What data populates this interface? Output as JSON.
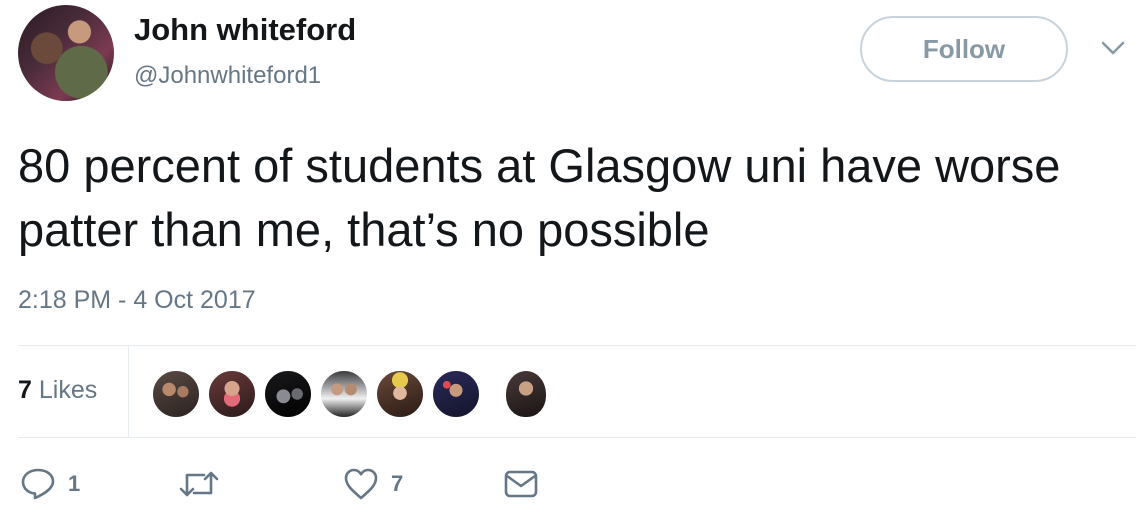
{
  "author": {
    "name": "John whiteford",
    "handle": "@Johnwhiteford1"
  },
  "follow_label": "Follow",
  "tweet": {
    "text": "80 percent of students at Glasgow uni have worse patter than me, that’s no possible",
    "timestamp": "2:18 PM - 4 Oct 2017"
  },
  "likes": {
    "count": "7",
    "label": "Likes"
  },
  "likers": [
    {
      "icon": "liker-avatar-1"
    },
    {
      "icon": "liker-avatar-2"
    },
    {
      "icon": "liker-avatar-3"
    },
    {
      "icon": "liker-avatar-4"
    },
    {
      "icon": "liker-avatar-5"
    },
    {
      "icon": "liker-avatar-6"
    },
    {
      "icon": "liker-avatar-7"
    }
  ],
  "actions": {
    "reply": {
      "icon": "reply-icon",
      "count": "1"
    },
    "retweet": {
      "icon": "retweet-icon",
      "count": ""
    },
    "like": {
      "icon": "heart-icon",
      "count": "7"
    },
    "message": {
      "icon": "envelope-icon",
      "count": ""
    }
  },
  "colors": {
    "text": "#14171a",
    "secondary": "#657786",
    "border": "#e6ecf0",
    "follow_border": "#c9d3dc"
  }
}
